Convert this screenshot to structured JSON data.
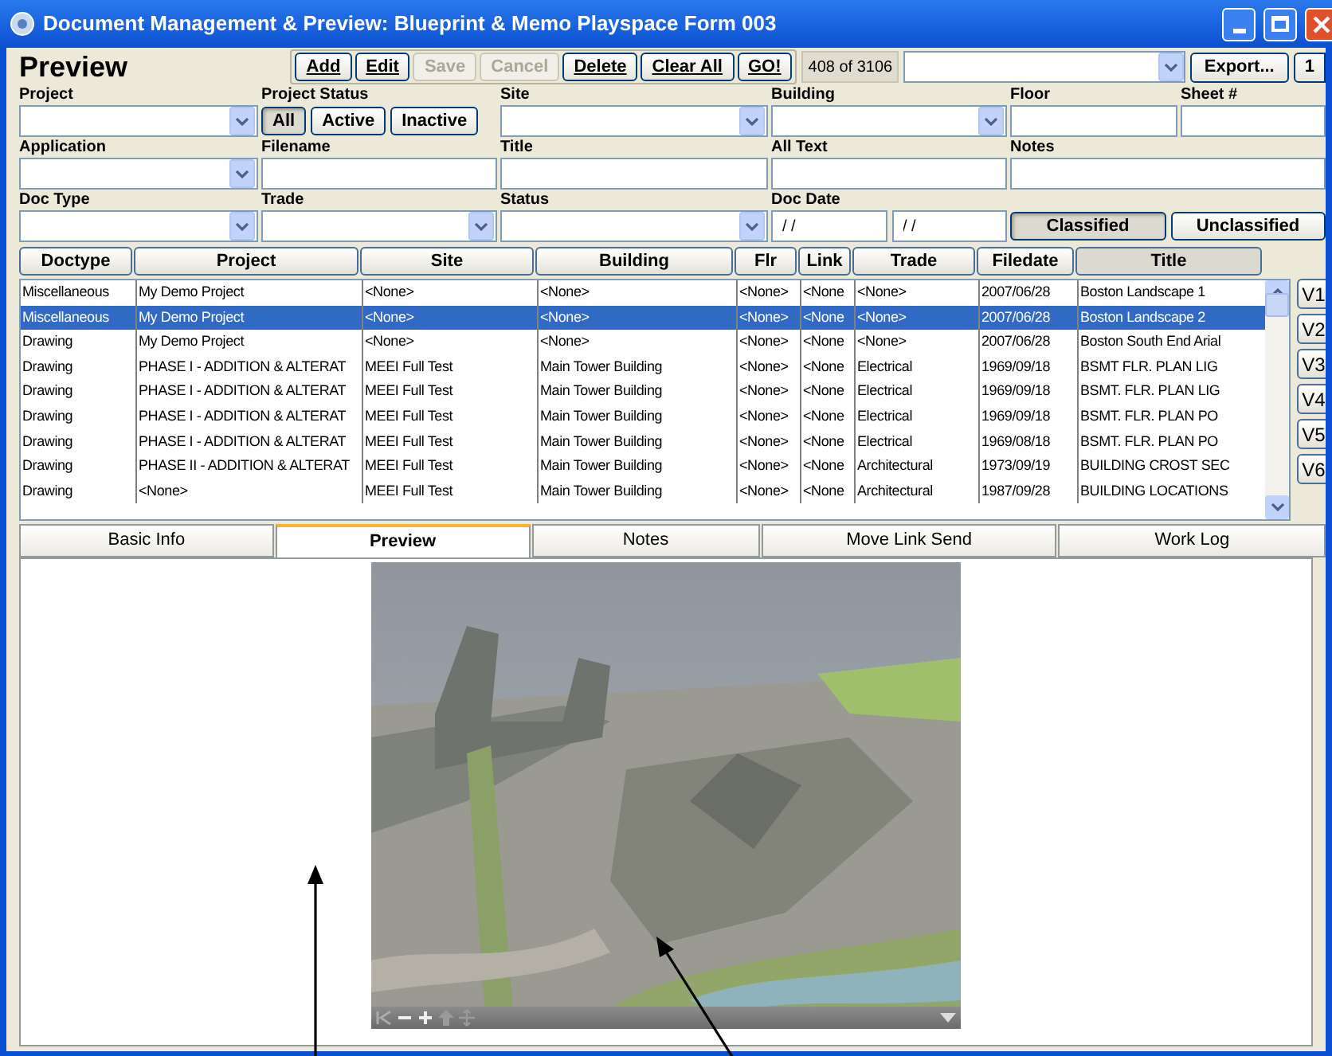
{
  "window": {
    "title": "Document Management & Preview: Blueprint & Memo Playspace Form 003"
  },
  "header": {
    "title": "Preview",
    "buttons": [
      {
        "label": "Add",
        "disabled": false
      },
      {
        "label": "Edit",
        "disabled": false
      },
      {
        "label": "Save",
        "disabled": true
      },
      {
        "label": "Cancel",
        "disabled": true
      },
      {
        "label": "Delete",
        "disabled": false
      },
      {
        "label": "Clear All",
        "disabled": false
      },
      {
        "label": "GO!",
        "disabled": false
      }
    ],
    "record_count": "408 of 3106",
    "export_button": "Export...",
    "page_button": "1"
  },
  "filters": [
    [
      {
        "kind": "select",
        "label": "Project"
      },
      {
        "kind": "buttons",
        "label": "Project Status",
        "options": [
          {
            "label": "All",
            "selected": true
          },
          {
            "label": "Active",
            "selected": false
          },
          {
            "label": "Inactive",
            "selected": false
          }
        ]
      },
      {
        "kind": "select",
        "label": "Site"
      },
      {
        "kind": "select",
        "label": "Building"
      },
      {
        "kind": "text",
        "label": "Floor"
      },
      {
        "kind": "text",
        "label": "Sheet #"
      }
    ],
    [
      {
        "kind": "select",
        "label": "Application"
      },
      {
        "kind": "text",
        "label": "Filename"
      },
      {
        "kind": "text",
        "label": "Title"
      },
      {
        "kind": "text",
        "label": "All Text"
      },
      {
        "kind": "text",
        "label": "Notes"
      }
    ],
    [
      {
        "kind": "select",
        "label": "Doc Type"
      },
      {
        "kind": "select",
        "label": "Trade"
      },
      {
        "kind": "select",
        "label": "Status"
      },
      {
        "kind": "date",
        "label": "Doc Date",
        "values": [
          "/ /",
          "/ /"
        ]
      },
      {
        "kind": "buttons",
        "options": [
          {
            "label": "Classified",
            "selected": true
          },
          {
            "label": "Unclassified",
            "selected": false
          }
        ]
      }
    ]
  ],
  "table": {
    "columns": [
      {
        "label": "Doctype",
        "selected": false
      },
      {
        "label": "Project",
        "selected": false
      },
      {
        "label": "Site",
        "selected": false
      },
      {
        "label": "Building",
        "selected": false
      },
      {
        "label": "Flr",
        "selected": false
      },
      {
        "label": "Link",
        "selected": false
      },
      {
        "label": "Trade",
        "selected": false
      },
      {
        "label": "Filedate",
        "selected": false
      },
      {
        "label": "Title",
        "selected": true
      }
    ],
    "rows": [
      {
        "selected": false,
        "cells": [
          "Miscellaneous",
          "My Demo Project",
          "<None>",
          "<None>",
          "<None>",
          "<None",
          "<None>",
          "2007/06/28",
          "Boston Landscape 1"
        ]
      },
      {
        "selected": true,
        "cells": [
          "Miscellaneous",
          "My Demo Project",
          "<None>",
          "<None>",
          "<None>",
          "<None",
          "<None>",
          "2007/06/28",
          "Boston Landscape 2"
        ]
      },
      {
        "selected": false,
        "cells": [
          "Drawing",
          "My Demo Project",
          "<None>",
          "<None>",
          "<None>",
          "<None",
          "<None>",
          "2007/06/28",
          "Boston South End Arial"
        ]
      },
      {
        "selected": false,
        "cells": [
          "Drawing",
          "PHASE I - ADDITION & ALTERAT",
          "MEEI Full Test",
          "Main Tower Building",
          "<None>",
          "<None",
          "Electrical",
          "1969/09/18",
          "BSMT FLR. PLAN LIG"
        ]
      },
      {
        "selected": false,
        "cells": [
          "Drawing",
          "PHASE I - ADDITION & ALTERAT",
          "MEEI Full Test",
          "Main Tower Building",
          "<None>",
          "<None",
          "Electrical",
          "1969/09/18",
          "BSMT. FLR. PLAN LIG"
        ]
      },
      {
        "selected": false,
        "cells": [
          "Drawing",
          "PHASE I - ADDITION & ALTERAT",
          "MEEI Full Test",
          "Main Tower Building",
          "<None>",
          "<None",
          "Electrical",
          "1969/09/18",
          "BSMT. FLR. PLAN PO"
        ]
      },
      {
        "selected": false,
        "cells": [
          "Drawing",
          "PHASE I - ADDITION & ALTERAT",
          "MEEI Full Test",
          "Main Tower Building",
          "<None>",
          "<None",
          "Electrical",
          "1969/08/18",
          "BSMT. FLR. PLAN PO"
        ]
      },
      {
        "selected": false,
        "cells": [
          "Drawing",
          "PHASE II - ADDITION & ALTERAT",
          "MEEI Full Test",
          "Main Tower Building",
          "<None>",
          "<None",
          "Architectural",
          "1973/09/19",
          "BUILDING CROST SEC"
        ]
      },
      {
        "selected": false,
        "cells": [
          "Drawing",
          "<None>",
          "MEEI Full Test",
          "Main Tower Building",
          "<None>",
          "<None",
          "Architectural",
          "1987/09/28",
          "BUILDING LOCATIONS"
        ]
      }
    ]
  },
  "view_buttons": [
    "V1",
    "V2",
    "V3",
    "V4",
    "V5",
    "V6"
  ],
  "tabs": [
    {
      "label": "Basic Info",
      "selected": false
    },
    {
      "label": "Preview",
      "selected": true
    },
    {
      "label": "Notes",
      "selected": false
    },
    {
      "label": "Move Link Send",
      "selected": false
    },
    {
      "label": "Work Log",
      "selected": false
    }
  ],
  "preview": {
    "kind": "picture"
  }
}
